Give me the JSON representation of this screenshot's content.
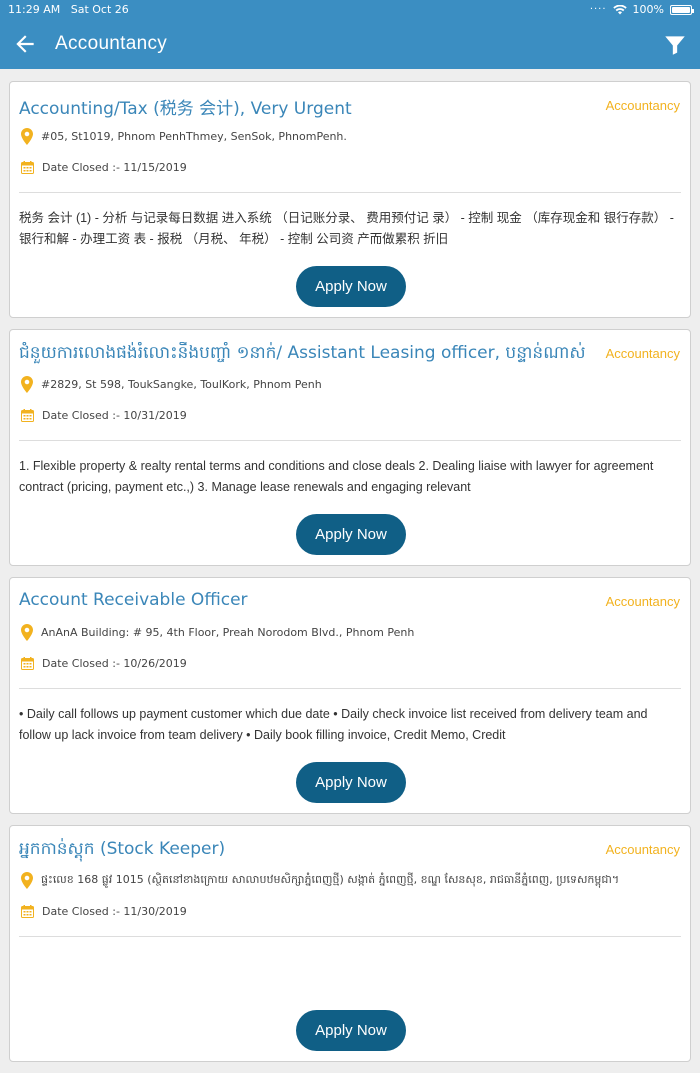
{
  "status_bar": {
    "time": "11:29 AM",
    "date": "Sat Oct 26",
    "battery": "100%",
    "battery_level": 1.0
  },
  "app_bar": {
    "title": "Accountancy"
  },
  "jobs": [
    {
      "title": "Accounting/Tax (税务 会计), Very Urgent",
      "category": "Accountancy",
      "location": "#05, St1019, Phnom PenhThmey, SenSok, PhnomPenh.",
      "date_closed": "Date Closed :- 11/15/2019",
      "description": "税务 会计 (1) - 分析 与记录每日数据 进入系统 （日记账分录、 费用预付记 录） - 控制 现金 （库存现金和 银行存款） - 银行和解 - 办理工资 表 - 报税 （月税、 年税） - 控制 公司资 产而做累积 折旧",
      "apply_label": "Apply Now"
    },
    {
      "title": "ជំនួយការលោងផង់រំលោះនឹងបញ្ចាំ ១នាក់/ Assistant Leasing officer, បន្ទាន់ណាស់",
      "category": "Accountancy",
      "location": "#2829, St 598, ToukSangke, ToulKork, Phnom Penh",
      "date_closed": "Date Closed :- 10/31/2019",
      "description": "1. Flexible property & realty rental terms and conditions and close deals 2. Dealing liaise with lawyer for agreement contract (pricing, payment etc.,) 3. Manage lease renewals and engaging relevant",
      "apply_label": "Apply Now"
    },
    {
      "title": "Account Receivable Officer",
      "category": "Accountancy",
      "location": "AnAnA Building: # 95, 4th Floor, Preah Norodom Blvd., Phnom Penh",
      "date_closed": "Date Closed :- 10/26/2019",
      "description": "• Daily call follows up payment customer which due date • Daily check invoice list received from delivery team and follow up lack invoice from team delivery • Daily book filling invoice, Credit Memo, Credit",
      "apply_label": "Apply Now"
    },
    {
      "title": "អ្នកកាន់ស្តុក (Stock Keeper)",
      "category": "Accountancy",
      "location": "ផ្ទះលេខ 168 ផ្លូវ 1015 (ស្ថិតនៅខាងក្រោយ សាលាបឋមសិក្សាភ្នំពេញថ្មី) សង្កាត់ ភ្នំពេញថ្មី, ខណ្ឌ សែនសុខ, រាជធានីភ្នំពេញ, ប្រទេសកម្ពុជា។",
      "date_closed": "Date Closed :- 11/30/2019",
      "description": "",
      "apply_label": "Apply Now"
    }
  ],
  "colors": {
    "primary": "#3b8ec2",
    "title": "#3a86b8",
    "category": "#f2b21f",
    "button": "#105f86"
  },
  "icons": {
    "back": "arrow-left-icon",
    "filter": "filter-icon",
    "location": "map-pin-icon",
    "date": "calendar-icon"
  }
}
